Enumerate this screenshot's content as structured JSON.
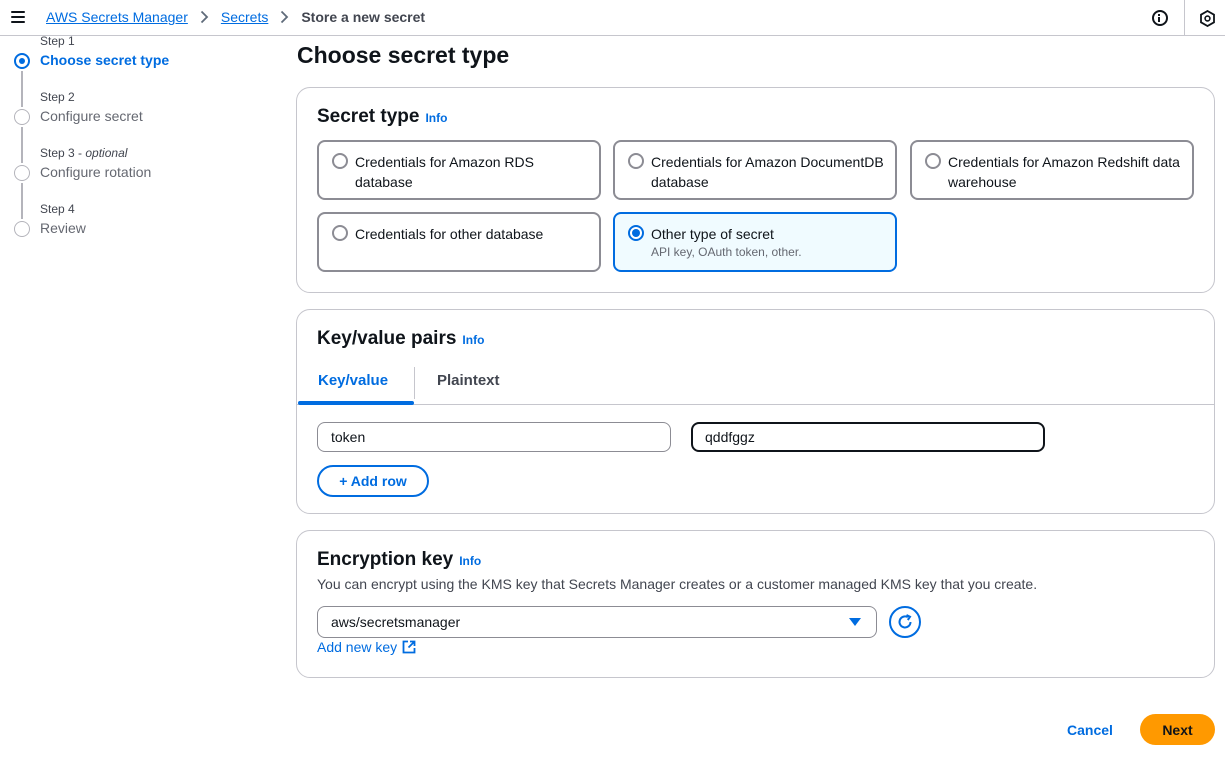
{
  "breadcrumb": {
    "items": [
      "AWS Secrets Manager",
      "Secrets"
    ],
    "current": "Store a new secret"
  },
  "steps": [
    {
      "small": "Step 1",
      "label": "Choose secret type",
      "active": true
    },
    {
      "small": "Step 2",
      "label": "Configure secret",
      "active": false
    },
    {
      "small": "Step 3",
      "optional": "optional",
      "label": "Configure rotation",
      "active": false
    },
    {
      "small": "Step 4",
      "label": "Review",
      "active": false
    }
  ],
  "page_title": "Choose secret type",
  "secret_type": {
    "title": "Secret type",
    "info": "Info",
    "options": [
      {
        "label": "Credentials for Amazon RDS database",
        "selected": false
      },
      {
        "label": "Credentials for Amazon DocumentDB database",
        "selected": false
      },
      {
        "label": "Credentials for Amazon Redshift data warehouse",
        "selected": false
      },
      {
        "label": "Credentials for other database",
        "selected": false
      },
      {
        "label": "Other type of secret",
        "desc": "API key, OAuth token, other.",
        "selected": true
      }
    ]
  },
  "kv": {
    "title": "Key/value pairs",
    "info": "Info",
    "tabs": [
      "Key/value",
      "Plaintext"
    ],
    "key_value": "token",
    "value_value": "qddfggz",
    "add_row": "+ Add row"
  },
  "encryption": {
    "title": "Encryption key",
    "info": "Info",
    "description": "You can encrypt using the KMS key that Secrets Manager creates or a customer managed KMS key that you create.",
    "selected_key": "aws/secretsmanager",
    "add_key": "Add new key"
  },
  "footer": {
    "cancel": "Cancel",
    "next": "Next"
  },
  "colors": {
    "link": "#006ce0",
    "primary_button": "#ff9900",
    "selected_tile_bg": "#f0fbff"
  }
}
